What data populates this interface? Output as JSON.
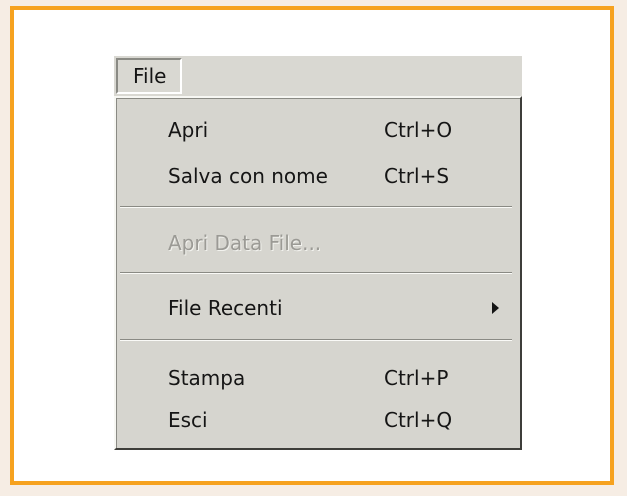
{
  "menu": {
    "title": "File",
    "items": [
      {
        "label": "Apri",
        "shortcut": "Ctrl+O"
      },
      {
        "label": "Salva con nome",
        "shortcut": "Ctrl+S"
      },
      {
        "label": "Apri Data File...",
        "shortcut": ""
      },
      {
        "label": "File Recenti",
        "shortcut": ""
      },
      {
        "label": "Stampa",
        "shortcut": "Ctrl+P"
      },
      {
        "label": "Esci",
        "shortcut": "Ctrl+Q"
      }
    ],
    "disabled_item": "Apri Data File...",
    "submenu_item": "File Recenti"
  },
  "colors": {
    "frame_border": "#f6a21f",
    "menu_background": "#d6d5cf",
    "disabled_text": "#9b9a95"
  },
  "icons": {
    "submenu_indicator": "chevron-right-icon"
  }
}
